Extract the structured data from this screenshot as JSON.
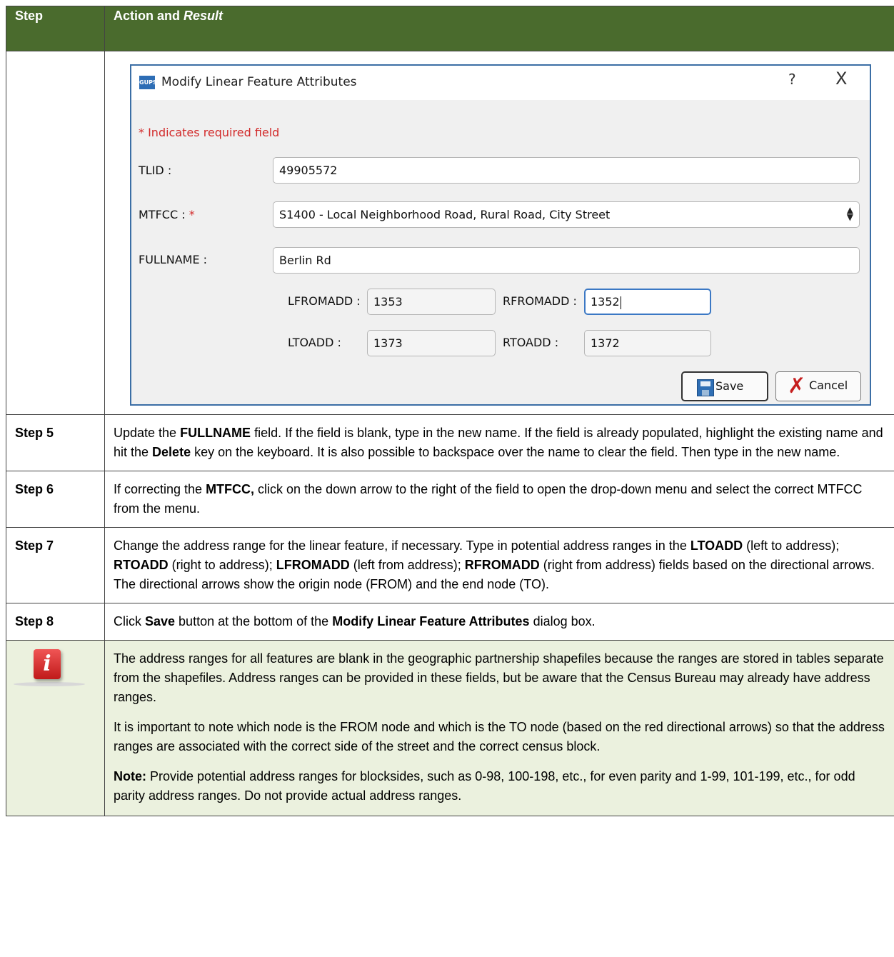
{
  "header": {
    "col_step": "Step",
    "col_action_prefix": "Action and ",
    "col_action_italic": "Result"
  },
  "dialog": {
    "title": "Modify Linear Feature Attributes",
    "app_icon_text": "GUPS",
    "help": "?",
    "close": "X",
    "required_note": "* Indicates required field",
    "tlid_label": "TLID :",
    "tlid_value": "49905572",
    "mtfcc_label": "MTFCC : ",
    "mtfcc_star": "*",
    "mtfcc_value": "S1400 - Local Neighborhood Road, Rural Road, City Street",
    "fullname_label": "FULLNAME :",
    "fullname_value": "Berlin Rd",
    "lfromadd_label": "LFROMADD :",
    "lfromadd_value": "1353",
    "rfromadd_label": "RFROMADD :",
    "rfromadd_value": "1352",
    "ltoadd_label": "LTOADD :",
    "ltoadd_value": "1373",
    "rtoadd_label": "RTOADD :",
    "rtoadd_value": "1372",
    "save_label": "Save",
    "cancel_label": "Cancel"
  },
  "steps": [
    {
      "step": "Step 5",
      "parts": [
        "Update the ",
        "FULLNAME",
        " field. If the field is blank, type in the new name. If the field is already populated, highlight the existing name and hit the ",
        "Delete",
        " key on the keyboard. It is also possible to backspace over the name to clear the field. Then type in the new name."
      ]
    },
    {
      "step": "Step 6",
      "parts": [
        "If correcting the ",
        "MTFCC,",
        " click on the down arrow to the right of the field to open the drop-down menu and select the correct MTFCC from the menu."
      ]
    },
    {
      "step": "Step 7",
      "parts": [
        "Change the address range for the linear feature, if necessary. Type in potential address ranges in the ",
        "LTOADD",
        " (left to address); ",
        "RTOADD",
        " (right to address); ",
        "LFROMADD",
        " (left from address); ",
        "RFROMADD",
        " (right from address) fields based on the directional arrows. The directional arrows show the origin node (FROM) and the end node (TO)."
      ]
    },
    {
      "step": "Step 8",
      "parts": [
        "Click ",
        "Save",
        " button at the bottom of the ",
        "Modify Linear Feature Attributes",
        " dialog box."
      ]
    }
  ],
  "note": {
    "icon": "info-icon",
    "icon_letter": "i",
    "p1": "The address ranges for all features are blank in the geographic partnership shapefiles because the ranges are stored in tables separate from the shapefiles. Address ranges can be provided in these fields, but be aware that the Census Bureau may already have address ranges.",
    "p2": "It is important to note which node is the FROM node and which is the TO node (based on the red directional arrows) so that the address ranges are associated with the correct side of the street and the correct census block.",
    "p3_bold": "Note:",
    "p3_rest": "  Provide potential address ranges for blocksides, such as 0-98, 100-198, etc., for even parity and 1-99, 101-199, etc., for odd parity address ranges. Do not provide actual address ranges."
  },
  "colors": {
    "header_bg": "#4a6b2d",
    "note_bg": "#ebf1de",
    "required_red": "#d22a2a"
  }
}
